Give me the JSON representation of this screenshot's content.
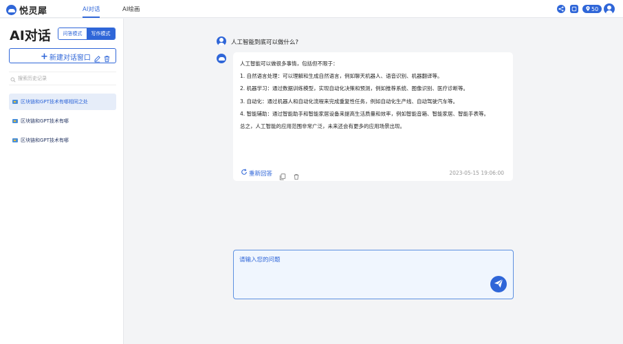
{
  "brand": {
    "name": "悦灵犀"
  },
  "nav": {
    "chat_label": "AI对话",
    "draw_label": "AI绘画"
  },
  "header": {
    "points": "50"
  },
  "sidebar": {
    "title": "AI对话",
    "mode_qa": "问答模式",
    "mode_write": "写作模式",
    "new_chat_label": "新建对话窗口",
    "search_placeholder": "搜索历史记录",
    "history": [
      {
        "label": "区块链和GPT技术有哪相同之处"
      },
      {
        "label": "区块链和GPT技术有哪"
      },
      {
        "label": "区块链和GPT技术有哪"
      }
    ]
  },
  "chat": {
    "question": "人工智能到底可以做什么?",
    "answer_lines": [
      "人工智能可以做很多事情，包括但不限于：",
      "1. 自然语言处理：可以理解和生成自然语言，例如聊天机器人、语音识别、机器翻译等。",
      "2. 机器学习：通过数据训练模型，实现自动化决策和预测，例如推荐系统、图像识别、医疗诊断等。",
      "3. 自动化：通过机器人和自动化流程来完成重复性任务，例如自动化生产线、自动驾驶汽车等。",
      "4. 智能辅助：通过智能助手和智能家居设备来提高生活质量和效率，例如智能音箱、智能家居、智能手表等。",
      "总之，人工智能的应用范围非常广泛，未来还会有更多的应用场景出现。"
    ],
    "regenerate_label": "重新回答",
    "timestamp": "2023-05-15 19:06:00"
  },
  "input": {
    "placeholder": "请输入您的问题"
  },
  "colors": {
    "accent": "#2f66d8",
    "bg": "#f3f4f6"
  }
}
